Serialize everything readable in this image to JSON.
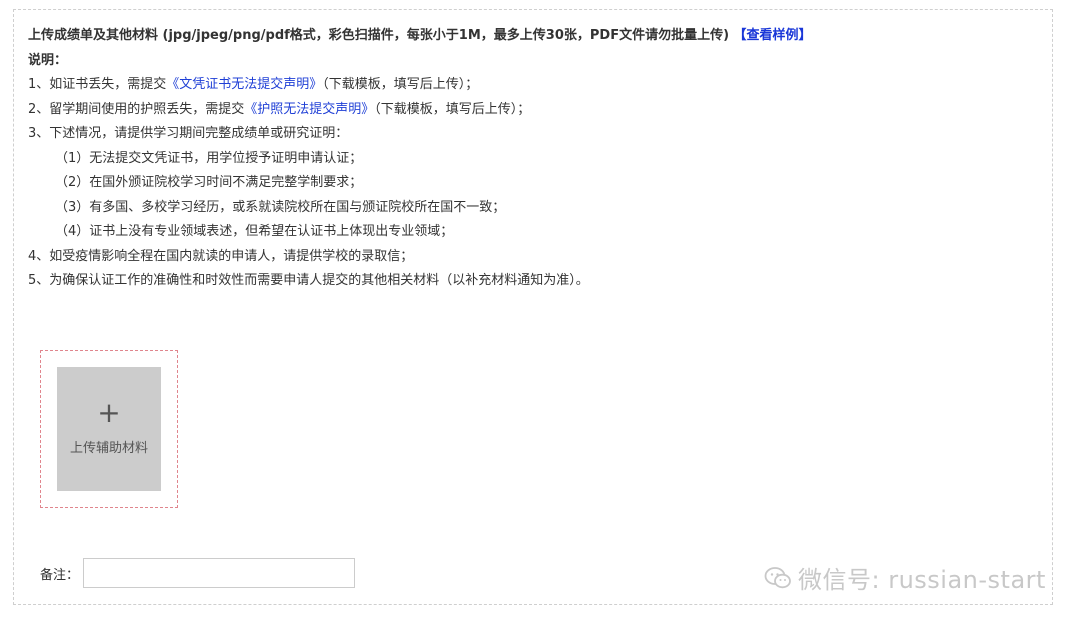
{
  "header": {
    "title": "上传成绩单及其他材料 (jpg/jpeg/png/pdf格式，彩色扫描件，每张小于1M，最多上传30张，PDF文件请勿批量上传)",
    "sample_link": "【查看样例】"
  },
  "notes": {
    "label": "说明：",
    "item1": {
      "prefix": "1、如证书丢失，需提交",
      "link": "《文凭证书无法提交声明》",
      "suffix": "（下载模板，填写后上传）；"
    },
    "item2": {
      "prefix": "2、留学期间使用的护照丢失，需提交",
      "link": "《护照无法提交声明》",
      "suffix": "（下载模板，填写后上传）；"
    },
    "item3": "3、下述情况，请提供学习期间完整成绩单或研究证明：",
    "sub1": "（1）无法提交文凭证书，用学位授予证明申请认证；",
    "sub2": "（2）在国外颁证院校学习时间不满足完整学制要求；",
    "sub3": "（3）有多国、多校学习经历，或系就读院校所在国与颁证院校所在国不一致；",
    "sub4": "（4）证书上没有专业领域表述，但希望在认证书上体现出专业领域；",
    "item4": "4、如受疫情影响全程在国内就读的申请人，请提供学校的录取信；",
    "item5": "5、为确保认证工作的准确性和时效性而需要申请人提交的其他相关材料（以补充材料通知为准）。"
  },
  "upload": {
    "icon": "plus-icon",
    "plus": "+",
    "label": "上传辅助材料"
  },
  "remark": {
    "label": "备注：",
    "value": ""
  },
  "watermark": {
    "icon": "wechat-icon",
    "text": "微信号: russian-start"
  }
}
